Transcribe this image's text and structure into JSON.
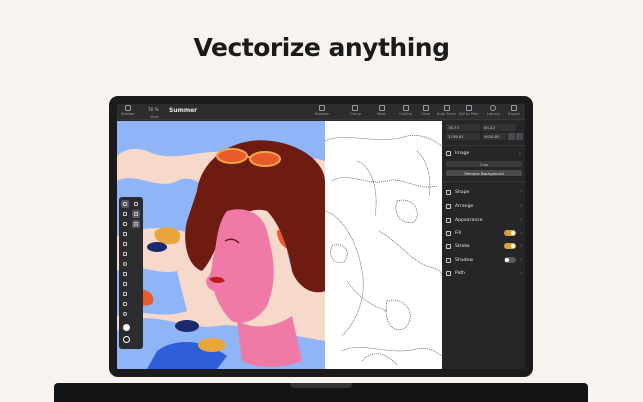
{
  "headline": "Vectorize anything",
  "toolbar": {
    "sidebar_label": "Sidebar",
    "view_label": "View",
    "zoom": "70 %",
    "doc_title": "Summer",
    "right_items": [
      {
        "label": "Boolean",
        "icon": "boolean-icon"
      },
      {
        "label": "Group",
        "icon": "group-icon"
      },
      {
        "label": "Mask",
        "icon": "mask-icon"
      },
      {
        "label": "Outline",
        "icon": "outline-icon"
      },
      {
        "label": "Clear",
        "icon": "clear-icon"
      },
      {
        "label": "Auto Trace",
        "icon": "trace-icon"
      },
      {
        "label": "Set to Path",
        "icon": "path-icon"
      },
      {
        "label": "Library",
        "icon": "library-icon"
      },
      {
        "label": "Export",
        "icon": "export-icon"
      }
    ]
  },
  "inspector": {
    "x": "78.73",
    "y": "63.22",
    "w": "2749.81",
    "h": "4426.85",
    "image_section": "Image",
    "crop_label": "Crop",
    "remove_bg_label": "Remove Background",
    "sections": [
      {
        "label": "Shape",
        "icon": "shape-icon",
        "toggle": null
      },
      {
        "label": "Arrange",
        "icon": "arrange-icon",
        "toggle": null
      },
      {
        "label": "Appearance",
        "icon": "appearance-icon",
        "toggle": null
      },
      {
        "label": "Fill",
        "icon": "fill-icon",
        "toggle": "on"
      },
      {
        "label": "Stroke",
        "icon": "stroke-icon",
        "toggle": "on"
      },
      {
        "label": "Shadow",
        "icon": "shadow-icon",
        "toggle": "off"
      },
      {
        "label": "Path",
        "icon": "path-icon",
        "toggle": null
      }
    ]
  },
  "colors": {
    "accent": "#d6a23a",
    "skin": "#f07aa6",
    "hair": "#6e1b12",
    "sky": "#8fb4f8",
    "orange": "#e95a2d"
  }
}
